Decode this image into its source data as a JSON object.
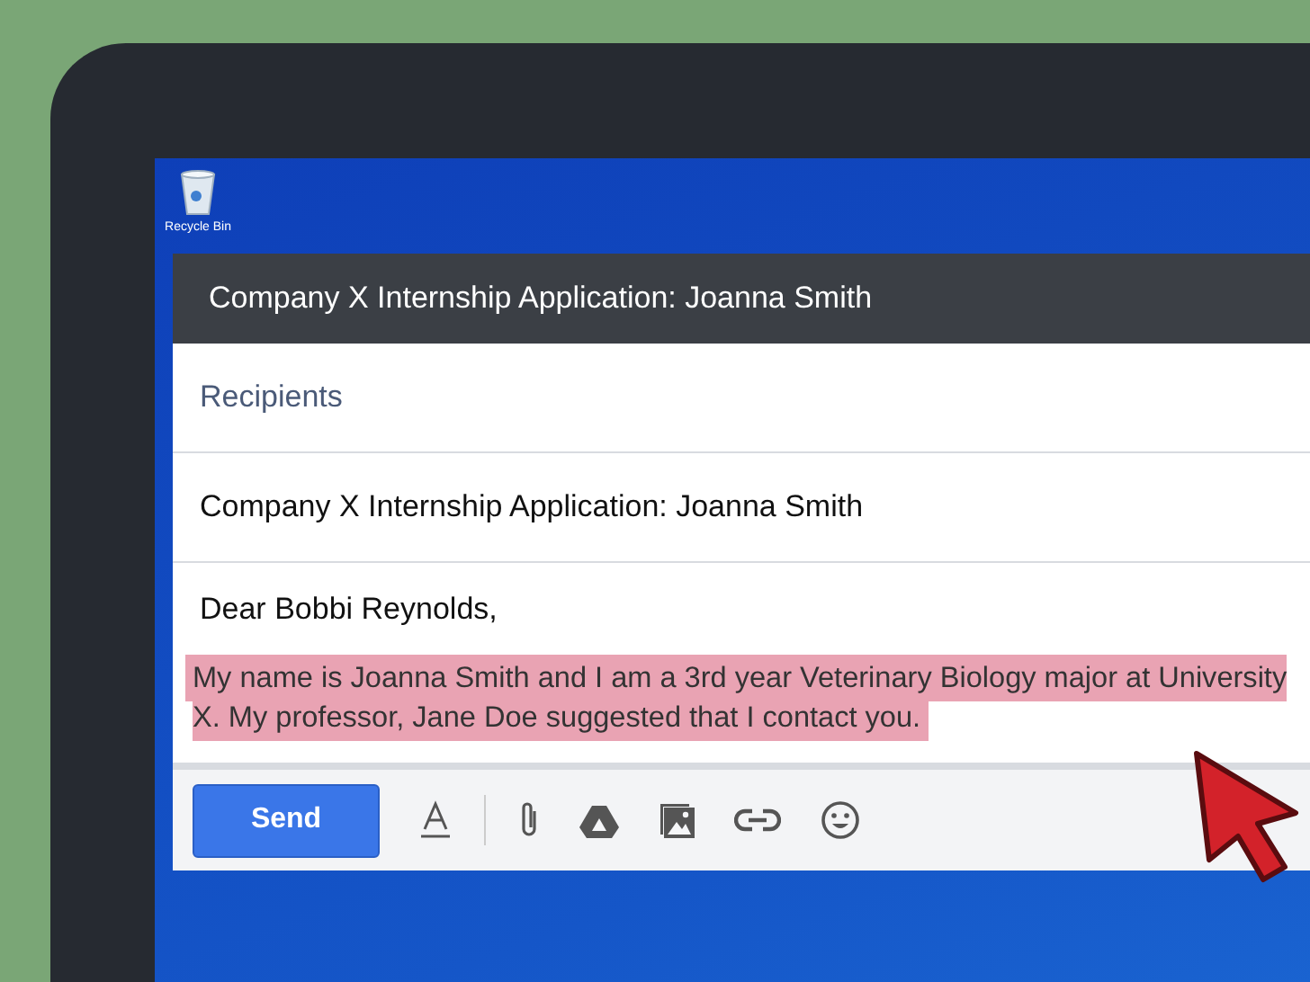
{
  "desktop": {
    "icons": [
      {
        "label": "Recycle Bin"
      }
    ]
  },
  "compose": {
    "title": "Company X Internship Application: Joanna Smith",
    "recipients": {
      "placeholder": "Recipients"
    },
    "subject": {
      "value": "Company X Internship Application: Joanna Smith"
    },
    "body": {
      "greeting": "Dear Bobbi Reynolds,",
      "paragraph": "My name is Joanna Smith and I am a 3rd year Veterinary Biology major at University X. My professor, Jane Doe suggested that I contact you.",
      "selected": true
    },
    "toolbar": {
      "send": "Send"
    }
  }
}
